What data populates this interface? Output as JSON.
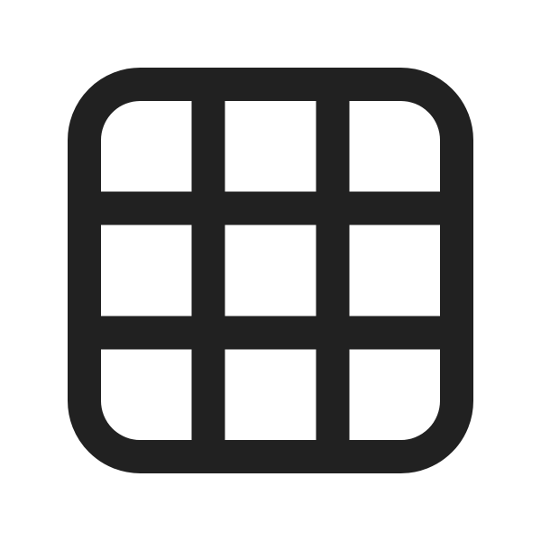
{
  "icon": {
    "name": "grid-3x3-icon",
    "rows": 3,
    "columns": 3,
    "color": "#212121",
    "background": "#ffffff"
  }
}
